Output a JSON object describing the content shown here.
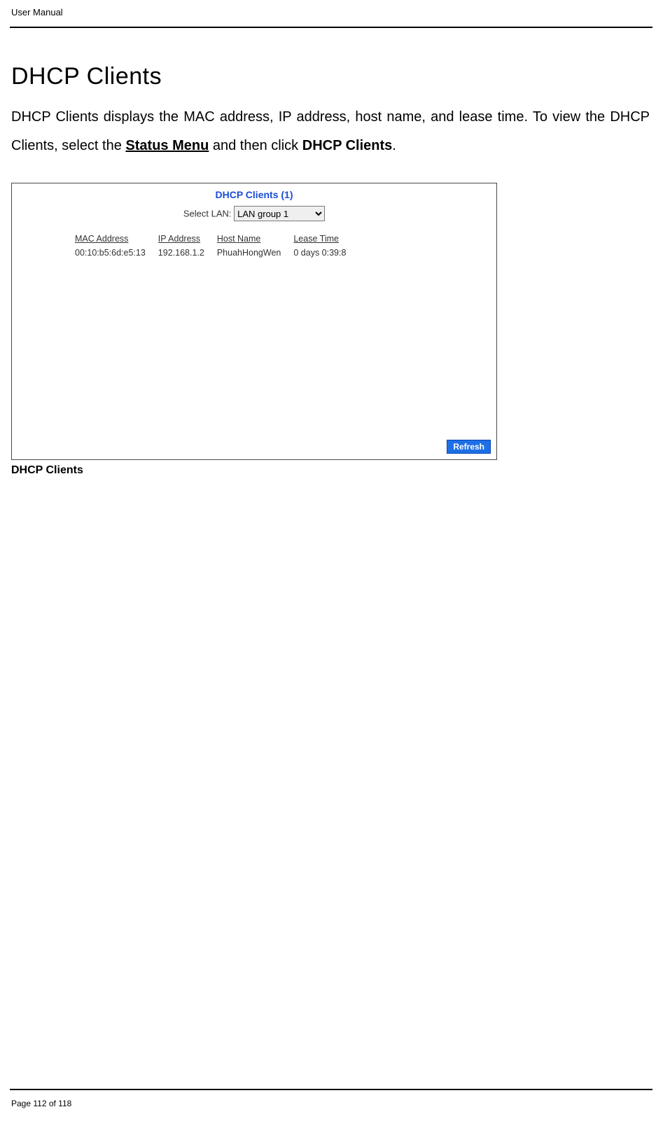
{
  "header": {
    "label": "User Manual"
  },
  "page": {
    "title": "DHCP Clients",
    "para_prefix": "DHCP Clients displays the MAC address, IP address, host name, and lease time. To view the DHCP Clients, select the ",
    "status_menu": "Status Menu",
    "para_mid": " and then click ",
    "dhcp_clients_link": "DHCP Clients",
    "para_suffix": "."
  },
  "panel": {
    "title": "DHCP Clients (1)",
    "select_label": "Select LAN:",
    "select_value": "LAN group 1",
    "columns": {
      "mac": "MAC Address",
      "ip": "IP Address",
      "host": "Host Name",
      "lease": "Lease Time"
    },
    "rows": [
      {
        "mac": "00:10:b5:6d:e5:13",
        "ip": "192.168.1.2",
        "host": "PhuahHongWen",
        "lease": "0 days 0:39:8"
      }
    ],
    "refresh": "Refresh"
  },
  "caption": "DHCP Clients",
  "footer": {
    "page_label": "Page 112 of 118"
  }
}
